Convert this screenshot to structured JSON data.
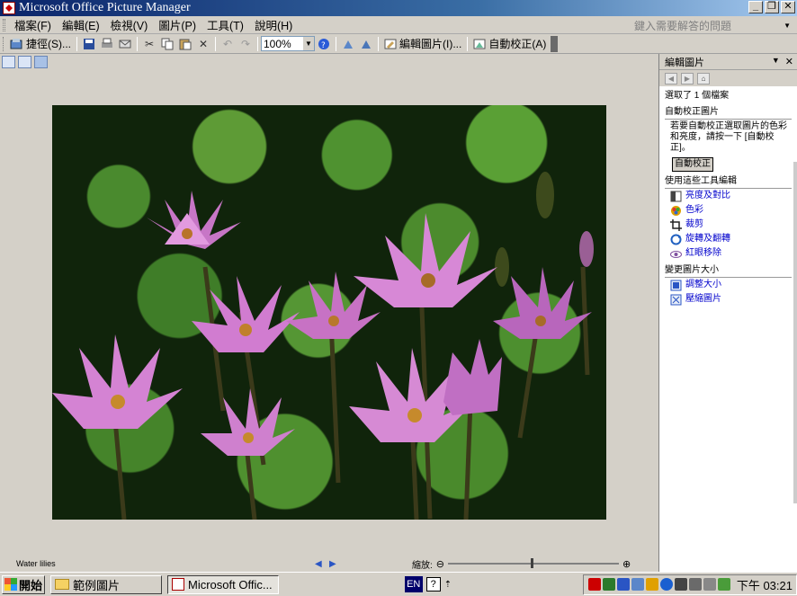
{
  "window": {
    "title": "Microsoft Office Picture Manager",
    "minimize": "_",
    "restore": "❐",
    "close": "✕"
  },
  "menu": {
    "items": [
      "檔案(F)",
      "編輯(E)",
      "檢視(V)",
      "圖片(P)",
      "工具(T)",
      "說明(H)"
    ],
    "help_placeholder": "鍵入需要解答的問題"
  },
  "toolbar": {
    "shortcuts_label": "捷徑(S)...",
    "zoom_value": "100%",
    "edit_pictures_label": "編輯圖片(I)...",
    "auto_correct_label": "自動校正(A)"
  },
  "status": {
    "filename": "Water lilies",
    "zoom_label": "縮放:"
  },
  "taskpane": {
    "title": "編輯圖片",
    "selected_text": "選取了 1 個檔案",
    "auto_correct_section": "自動校正圖片",
    "auto_correct_desc": "若要自動校正選取圖片的色彩和亮度，請按一下 [自動校正]。",
    "auto_correct_button": "自動校正",
    "tools_section": "使用這些工具編輯",
    "tools": [
      {
        "label": "亮度及對比",
        "icon": "brightness-icon",
        "color": "#444444"
      },
      {
        "label": "色彩",
        "icon": "color-icon",
        "color": "#e0a000"
      },
      {
        "label": "裁剪",
        "icon": "crop-icon",
        "color": "#222222"
      },
      {
        "label": "旋轉及翻轉",
        "icon": "rotate-icon",
        "color": "#2060c0"
      },
      {
        "label": "紅眼移除",
        "icon": "red-eye-icon",
        "color": "#8050a0"
      }
    ],
    "resize_section": "變更圖片大小",
    "resize_tools": [
      {
        "label": "調整大小",
        "icon": "resize-icon"
      },
      {
        "label": "壓縮圖片",
        "icon": "compress-icon"
      }
    ]
  },
  "taskbar": {
    "start": "開始",
    "tasks": [
      "範例圖片",
      "Microsoft Offic..."
    ],
    "lang": "EN",
    "clock": "下午 03:21"
  }
}
